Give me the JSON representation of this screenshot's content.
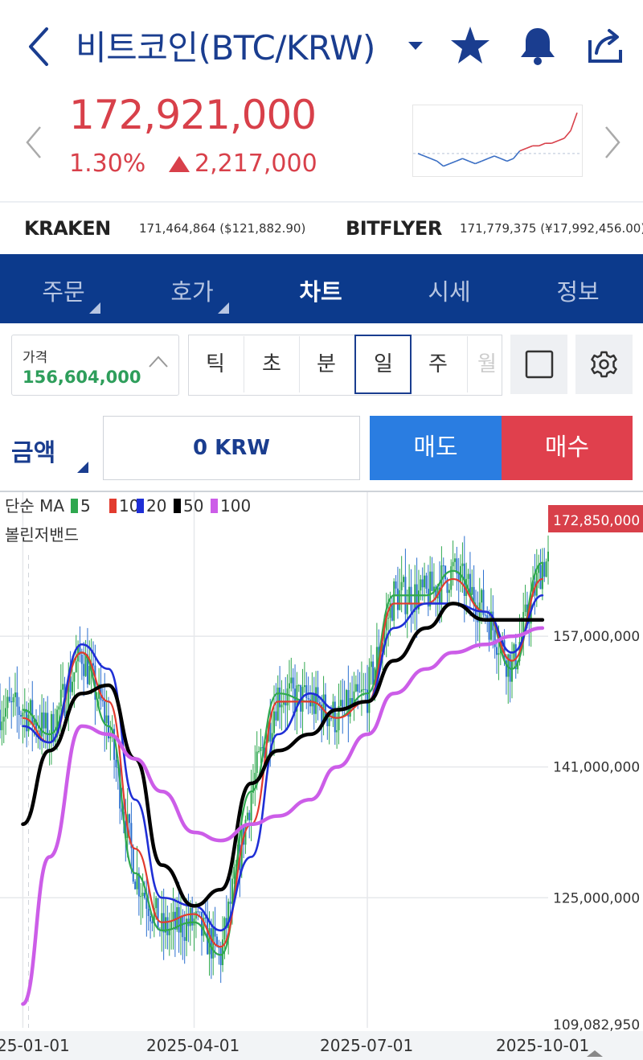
{
  "header": {
    "title": "비트코인(BTC/KRW)",
    "icons": [
      "back-arrow-icon",
      "dropdown-caret-icon",
      "star-icon",
      "bell-icon",
      "share-icon"
    ]
  },
  "ticker": {
    "price": "172,921,000",
    "change_pct": "1.30%",
    "change_amount": "2,217,000",
    "direction": "up",
    "color_up": "#d8404a"
  },
  "exchanges": [
    {
      "name": "KRAKEN",
      "value": "171,464,864 ($121,882.90)"
    },
    {
      "name": "BITFLYER",
      "value": "171,779,375 (¥17,992,456.00)"
    }
  ],
  "tabs": [
    {
      "label": "주문",
      "active": false
    },
    {
      "label": "호가",
      "active": false
    },
    {
      "label": "차트",
      "active": true
    },
    {
      "label": "시세",
      "active": false
    },
    {
      "label": "정보",
      "active": false
    }
  ],
  "price_selector": {
    "label": "가격",
    "value": "156,604,000"
  },
  "periods": [
    "틱",
    "초",
    "분",
    "일",
    "주",
    "월"
  ],
  "selected_period": "일",
  "order": {
    "amount_label": "금액",
    "amount_value": "0 KRW",
    "sell_label": "매도",
    "buy_label": "매수"
  },
  "legend": {
    "ma_label": "단순 MA",
    "ma_periods": [
      "5",
      "10",
      "20",
      "50",
      "100"
    ],
    "ma_colors": [
      "#2fa84f",
      "#e23b2e",
      "#1f2fd6",
      "#000000",
      "#cc5de8"
    ],
    "bollinger_label": "볼린저밴드"
  },
  "chart_data": {
    "type": "line",
    "title": "",
    "x_ticks": [
      "25-01-01",
      "2025-04-01",
      "2025-07-01",
      "2025-10-01"
    ],
    "y_ticks": [
      "109,082,950",
      "125,000,000",
      "141,000,000",
      "157,000,000"
    ],
    "current_price_label": "172,850,000",
    "ylim": [
      109082950,
      172850000
    ],
    "series": [
      {
        "name": "MA 5",
        "color": "#2fa84f",
        "x": [
          "2025-01-01",
          "2025-01-15",
          "2025-02-01",
          "2025-02-15",
          "2025-03-01",
          "2025-03-15",
          "2025-04-01",
          "2025-04-15",
          "2025-05-01",
          "2025-05-15",
          "2025-06-01",
          "2025-06-15",
          "2025-07-01",
          "2025-07-15",
          "2025-08-01",
          "2025-08-15",
          "2025-09-01",
          "2025-09-15",
          "2025-10-01"
        ],
        "values": [
          148000000,
          145000000,
          155000000,
          146000000,
          128000000,
          121000000,
          122000000,
          118000000,
          138000000,
          150000000,
          149000000,
          147000000,
          150000000,
          162000000,
          162000000,
          165000000,
          160000000,
          153000000,
          166000000
        ]
      },
      {
        "name": "MA 10",
        "color": "#e23b2e",
        "x": [
          "2025-01-01",
          "2025-01-15",
          "2025-02-01",
          "2025-02-15",
          "2025-03-01",
          "2025-03-15",
          "2025-04-01",
          "2025-04-15",
          "2025-05-01",
          "2025-05-15",
          "2025-06-01",
          "2025-06-15",
          "2025-07-01",
          "2025-07-15",
          "2025-08-01",
          "2025-08-15",
          "2025-09-01",
          "2025-09-15",
          "2025-10-01"
        ],
        "values": [
          147000000,
          144000000,
          155000000,
          149000000,
          131000000,
          122000000,
          123000000,
          119000000,
          134000000,
          149000000,
          149000000,
          147000000,
          149000000,
          161000000,
          161000000,
          164000000,
          160000000,
          154000000,
          164000000
        ]
      },
      {
        "name": "MA 20",
        "color": "#1f2fd6",
        "x": [
          "2025-01-01",
          "2025-01-15",
          "2025-02-01",
          "2025-02-15",
          "2025-03-01",
          "2025-03-15",
          "2025-04-01",
          "2025-04-15",
          "2025-05-01",
          "2025-05-15",
          "2025-06-01",
          "2025-06-15",
          "2025-07-01",
          "2025-07-15",
          "2025-08-01",
          "2025-08-15",
          "2025-09-01",
          "2025-09-15",
          "2025-10-01"
        ],
        "values": [
          146000000,
          144000000,
          156000000,
          153000000,
          137000000,
          125000000,
          124000000,
          121000000,
          130000000,
          145000000,
          150000000,
          148000000,
          149000000,
          158000000,
          161000000,
          161000000,
          160000000,
          155000000,
          162000000
        ]
      },
      {
        "name": "MA 50",
        "color": "#000000",
        "x": [
          "2025-01-01",
          "2025-01-15",
          "2025-02-01",
          "2025-02-15",
          "2025-03-01",
          "2025-03-15",
          "2025-04-01",
          "2025-04-15",
          "2025-05-01",
          "2025-05-15",
          "2025-06-01",
          "2025-06-15",
          "2025-07-01",
          "2025-07-15",
          "2025-08-01",
          "2025-08-15",
          "2025-09-01",
          "2025-09-15",
          "2025-10-01"
        ],
        "values": [
          134000000,
          143000000,
          150000000,
          151000000,
          142000000,
          129000000,
          124000000,
          126000000,
          139000000,
          143000000,
          145000000,
          148000000,
          149000000,
          154000000,
          158000000,
          161000000,
          159000000,
          159000000,
          159000000
        ]
      },
      {
        "name": "MA 100",
        "color": "#cc5de8",
        "x": [
          "2025-01-01",
          "2025-01-15",
          "2025-02-01",
          "2025-02-15",
          "2025-03-01",
          "2025-03-15",
          "2025-04-01",
          "2025-04-15",
          "2025-05-01",
          "2025-05-15",
          "2025-06-01",
          "2025-06-15",
          "2025-07-01",
          "2025-07-15",
          "2025-08-01",
          "2025-08-15",
          "2025-09-01",
          "2025-09-15",
          "2025-10-01"
        ],
        "values": [
          112000000,
          130000000,
          146000000,
          145000000,
          142000000,
          138000000,
          133000000,
          132000000,
          134000000,
          135000000,
          137000000,
          141000000,
          145000000,
          150000000,
          153000000,
          155000000,
          156000000,
          157000000,
          158000000
        ]
      }
    ],
    "grid": true,
    "sparkline": {
      "values": [
        150,
        149,
        148,
        147,
        145,
        146,
        147,
        148,
        147,
        146,
        147,
        148,
        149,
        148,
        147,
        148,
        151,
        152,
        153,
        153,
        154,
        154,
        155,
        156,
        159,
        166
      ],
      "baseline": 150
    }
  }
}
